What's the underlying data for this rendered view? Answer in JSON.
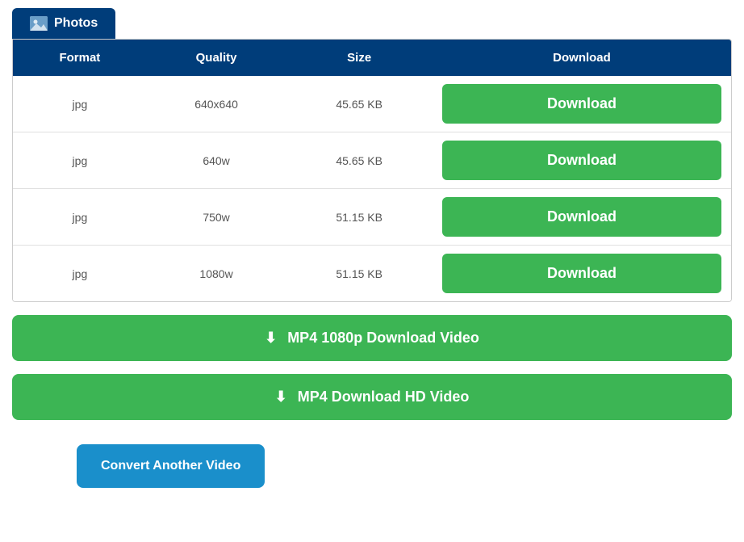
{
  "tab": {
    "label": "Photos",
    "icon": "photos-icon"
  },
  "table": {
    "headers": [
      "Format",
      "Quality",
      "Size",
      "Download"
    ],
    "rows": [
      {
        "format": "jpg",
        "quality": "640x640",
        "size": "45.65 KB",
        "download_label": "Download"
      },
      {
        "format": "jpg",
        "quality": "640w",
        "size": "45.65 KB",
        "download_label": "Download"
      },
      {
        "format": "jpg",
        "quality": "750w",
        "size": "51.15 KB",
        "download_label": "Download"
      },
      {
        "format": "jpg",
        "quality": "1080w",
        "size": "51.15 KB",
        "download_label": "Download"
      }
    ]
  },
  "action_buttons": [
    {
      "label": "MP4 1080p Download Video",
      "icon": "⬇"
    },
    {
      "label": "MP4 Download HD Video",
      "icon": "⬇"
    }
  ],
  "convert_button": {
    "label": "Convert Another Video"
  },
  "colors": {
    "dark_blue": "#003d7a",
    "green": "#3cb554",
    "blue_btn": "#1a8fcb"
  }
}
